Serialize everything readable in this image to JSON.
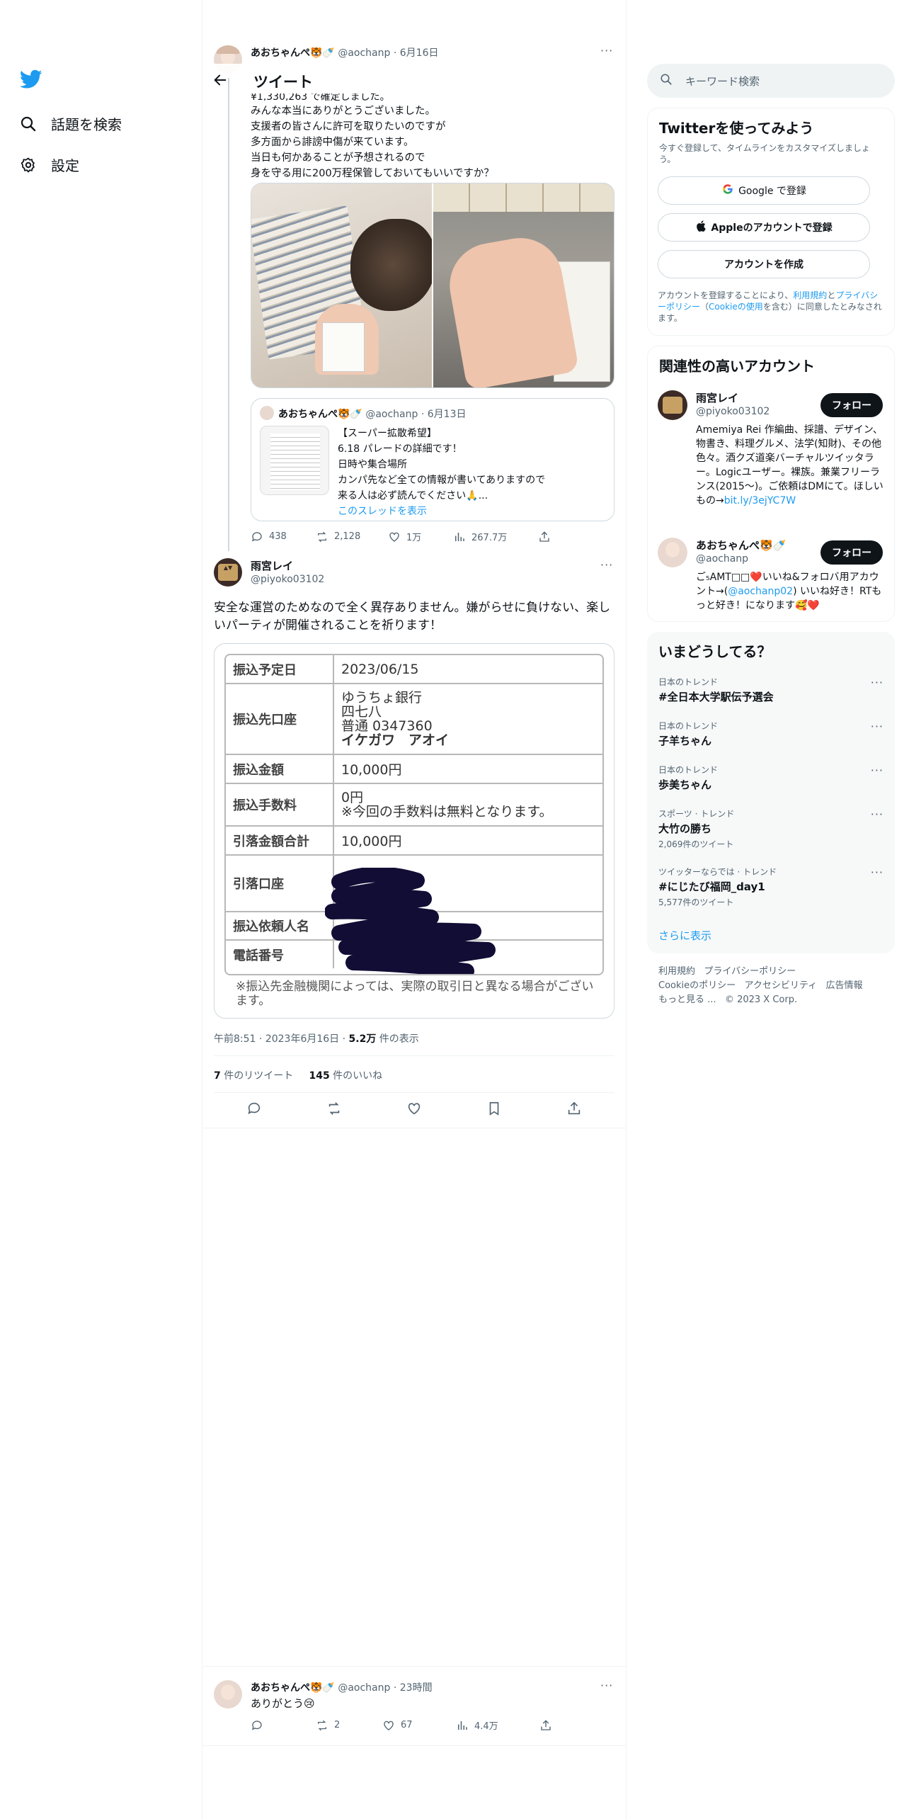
{
  "sidebar": {
    "logo": "twitter-bird-icon",
    "items": [
      {
        "label": "話題を検索",
        "icon": "search-icon"
      },
      {
        "label": "設定",
        "icon": "gear-icon"
      }
    ]
  },
  "header": {
    "title": "ツイート"
  },
  "quoted_top": {
    "name": "あおちゃんぺ🐯🍼",
    "handle": "@aochanp",
    "date": "6月16日",
    "text_lines": [
      "みんな本当にありがとうございました。",
      "支援者の皆さんに許可を取りたいのですが",
      "多方面から誹謗中傷が来ています。",
      "当日も何かあることが予想されるので",
      "身を守る用に200万程保管しておいてもいいですか？"
    ],
    "partial_line": "¥1,330,263 で確定しました。",
    "inner_quote": {
      "name": "あおちゃんぺ🐯🍼",
      "handle": "@aochanp",
      "date": "6月13日",
      "lines": [
        "【スーパー拡散希望】",
        "6.18 パレードの詳細です！",
        "日時や集合場所",
        "カンパ先など全ての情報が書いてありますので",
        "来る人は必ず読んでください🙏..."
      ],
      "show_thread": "このスレッドを表示"
    },
    "stats": {
      "replies": "438",
      "retweets": "2,128",
      "likes": "1万",
      "views": "267.7万"
    }
  },
  "main_tweet": {
    "name": "雨宮レイ",
    "handle": "@piyoko03102",
    "text": "安全な運営のためなので全く異存ありません。嫌がらせに負けない、楽しいパーティが開催されることを祈ります！",
    "slip": {
      "rows": [
        {
          "k": "振込予定日",
          "v": [
            "2023/06/15"
          ]
        },
        {
          "k": "振込先口座",
          "v": [
            "ゆうちょ銀行",
            "四七八",
            "普通 0347360",
            "イケガワ　アオイ"
          ]
        },
        {
          "k": "振込金額",
          "v": [
            "10,000円"
          ]
        },
        {
          "k": "振込手数料",
          "v": [
            "0円",
            "※今回の手数料は無料となります。"
          ]
        },
        {
          "k": "引落金額合計",
          "v": [
            "10,000円"
          ]
        },
        {
          "k": "引落口座",
          "v": []
        },
        {
          "k": "振込依頼人名",
          "v": []
        },
        {
          "k": "電話番号",
          "v": []
        }
      ],
      "note": "※振込先金融機関によっては、実際の取引日と異なる場合がございます。"
    },
    "time": "午前8:51",
    "date": "2023年6月16日",
    "views_count": "5.2万",
    "views_label": "件の表示",
    "retweets_count": "7",
    "retweets_label": "件のリツイート",
    "likes_count": "145",
    "likes_label": "件のいいね"
  },
  "reply": {
    "name": "あおちゃんぺ🐯🍼",
    "handle": "@aochanp",
    "time": "23時間",
    "text": "ありがとう😢",
    "stats": {
      "retweets": "2",
      "likes": "67",
      "views": "4.4万"
    }
  },
  "right": {
    "search_placeholder": "キーワード検索",
    "signup": {
      "title": "Twitterを使ってみよう",
      "subtitle": "今すぐ登録して、タイムラインをカスタマイズしましょう。",
      "google": "Google で登録",
      "apple": "Appleのアカウントで登録",
      "create": "アカウントを作成",
      "legal_1": "アカウントを登録することにより、",
      "legal_terms": "利用規約",
      "legal_2": "と",
      "legal_privacy": "プライバシーポリシー",
      "legal_3": "（",
      "legal_cookie": "Cookieの使用",
      "legal_4": "を含む）に同意したとみなされます。"
    },
    "relevant": {
      "title": "関連性の高いアカウント",
      "follow": "フォロー",
      "accounts": [
        {
          "name": "雨宮レイ",
          "handle": "@piyoko03102",
          "bio": "Amemiya Rei 作編曲、採譜、デザイン、物書き、料理グルメ、法学(知財)、その他色々。酒クズ道楽バーチャルツイッタラー。Logicユーザー。裸族。兼業フリーランス(2015〜)。ご依頼はDMにて。ほしいもの→",
          "bio_link": "bit.ly/3ejYC7W"
        },
        {
          "name": "あおちゃんぺ🐯🍼",
          "handle": "@aochanp",
          "bio": "ご₅AMT□□❤️いいね&フォロバ用アカウント→(",
          "bio_link": "@aochanp02",
          "bio_end": ") いいね好き！RTもっと好き！になります🥰❤️"
        }
      ]
    },
    "trends": {
      "title": "いまどうしてる？",
      "items": [
        {
          "meta": "日本のトレンド",
          "name": "#全日本大学駅伝予選会",
          "count": ""
        },
        {
          "meta": "日本のトレンド",
          "name": "子羊ちゃん",
          "count": ""
        },
        {
          "meta": "日本のトレンド",
          "name": "歩美ちゃん",
          "count": ""
        },
        {
          "meta": "スポーツ · トレンド",
          "name": "大竹の勝ち",
          "count": "2,069件のツイート"
        },
        {
          "meta": "ツイッターならでは · トレンド",
          "name": "#にじたび福岡_day1",
          "count": "5,577件のツイート"
        }
      ],
      "more": "さらに表示"
    },
    "footer": {
      "links": [
        "利用規約",
        "プライバシーポリシー",
        "Cookieのポリシー",
        "アクセシビリティ",
        "広告情報",
        "もっと見る ..."
      ],
      "copyright": "© 2023 X Corp."
    }
  }
}
